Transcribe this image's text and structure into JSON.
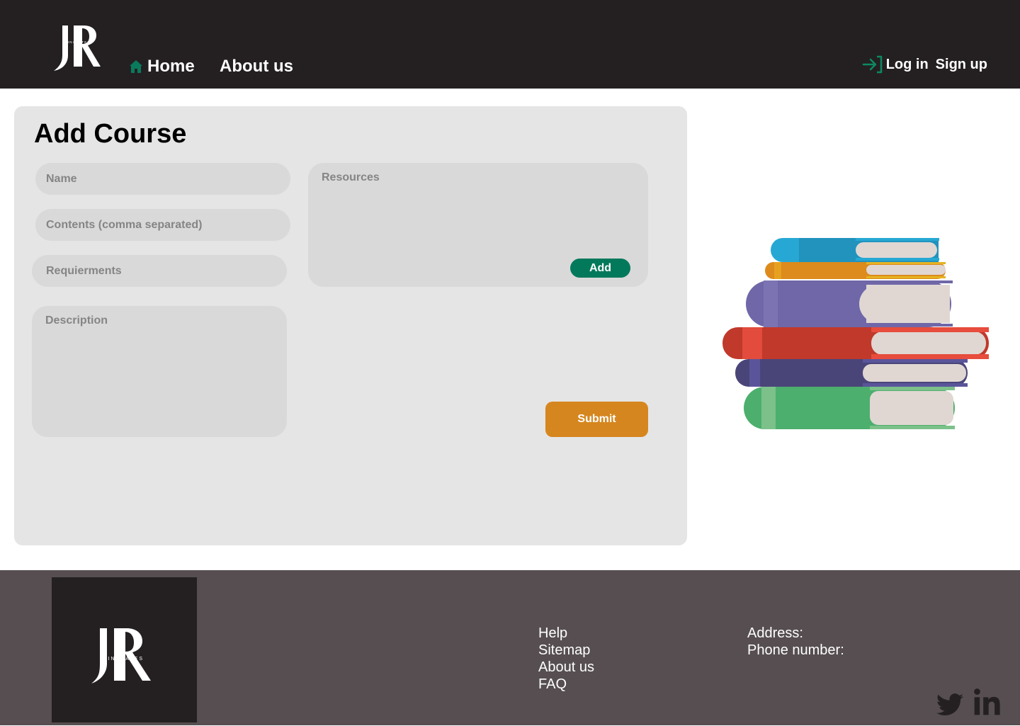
{
  "header": {
    "logo_text": "JR",
    "logo_subtext": "JINARATES",
    "nav": {
      "home": "Home",
      "about": "About us"
    },
    "auth": {
      "login": "Log in",
      "signup": "Sign up"
    }
  },
  "form": {
    "title": "Add Course",
    "name_placeholder": "Name",
    "contents_placeholder": "Contents (comma separated)",
    "requirements_placeholder": "Requierments",
    "description_placeholder": "Description",
    "resources_placeholder": "Resources",
    "add_label": "Add",
    "submit_label": "Submit"
  },
  "footer": {
    "links": [
      "Help",
      "Sitemap",
      "About us",
      "FAQ"
    ],
    "address_label": "Address:",
    "phone_label": "Phone number:"
  },
  "colors": {
    "header_bg": "#242021",
    "footer_bg": "#564e51",
    "accent_green": "#03795b",
    "accent_orange": "#d6861e"
  },
  "icons": [
    "home-icon",
    "login-arrow-icon",
    "twitter-icon",
    "linkedin-icon"
  ]
}
